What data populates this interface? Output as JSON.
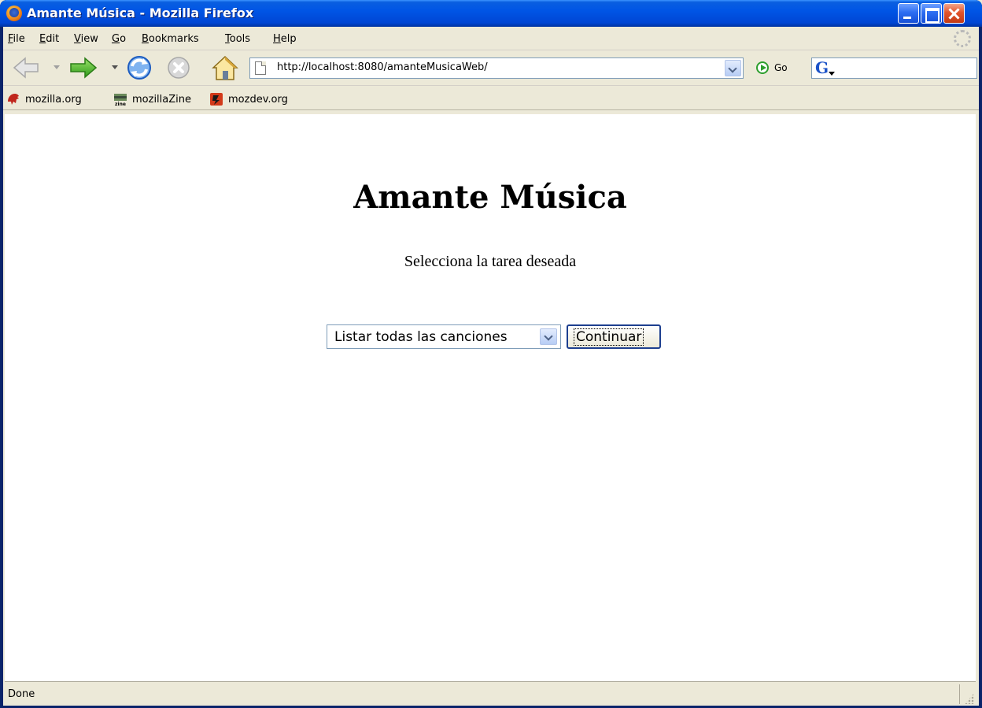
{
  "window": {
    "title": "Amante Música - Mozilla Firefox"
  },
  "menubar": {
    "items": [
      "File",
      "Edit",
      "View",
      "Go",
      "Bookmarks",
      "Tools",
      "Help"
    ]
  },
  "navigation": {
    "url": "http://localhost:8080/amanteMusicaWeb/",
    "go_label": "Go",
    "search_placeholder": ""
  },
  "bookmarks": {
    "items": [
      "mozilla.org",
      "mozillaZine",
      "mozdev.org"
    ]
  },
  "page": {
    "heading": "Amante Música",
    "subtitle": "Selecciona la tarea deseada",
    "task_select": {
      "selected": "Listar todas las canciones"
    },
    "continue_label": "Continuar"
  },
  "status": {
    "text": "Done"
  },
  "colors": {
    "titlebar": "#0055e5",
    "chrome": "#ece9d8",
    "content_bg": "#ffffff",
    "button_border": "#1d3f8f"
  },
  "icons": {
    "window": "firefox-icon",
    "back": "back-arrow-icon",
    "forward": "forward-arrow-icon",
    "reload": "reload-icon",
    "stop": "stop-icon",
    "home": "home-icon",
    "page": "page-icon",
    "go": "go-icon",
    "search": "google-search-icon",
    "throbber": "throbber-icon"
  }
}
